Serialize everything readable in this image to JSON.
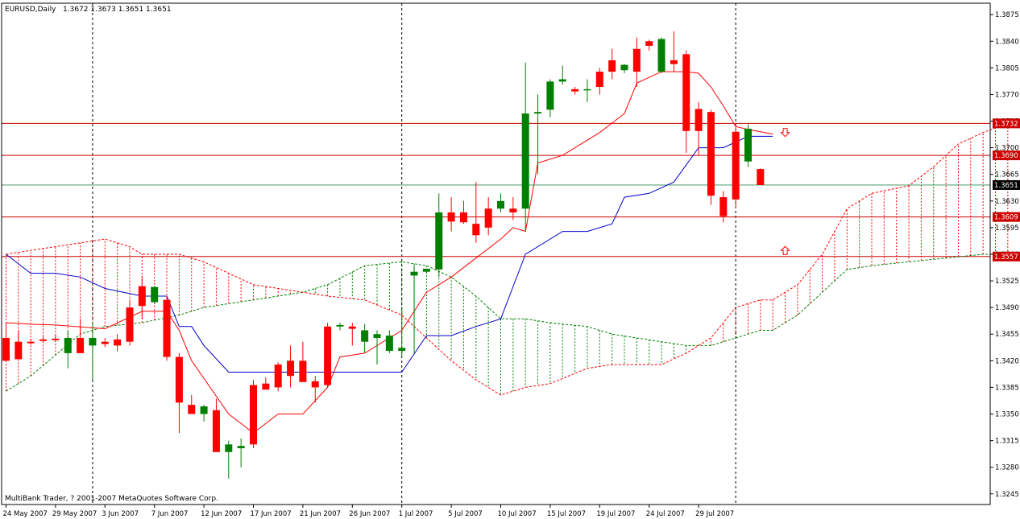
{
  "header": {
    "symbol": "EURUSD,Daily",
    "ohlc": "1.3672 1.3673 1.3651 1.3651"
  },
  "footer": {
    "copyright": "MultiBank Trader, ? 2001-2007 MetaQuotes Software Corp."
  },
  "colors": {
    "bull": "#008000",
    "bear": "#ff0000",
    "tenkan": "#ff0000",
    "kijun": "#0000cc",
    "span_a": "#008000",
    "span_b": "#ff0000",
    "hline": "#cc0000",
    "price_tag": "#000000"
  },
  "chart_data": {
    "type": "candlestick",
    "title": "",
    "ylim": [
      1.3231,
      1.389
    ],
    "y_ticks": [
      "1.3875",
      "1.3840",
      "1.3805",
      "1.3770",
      "1.3735",
      "1.3700",
      "1.3665",
      "1.3630",
      "1.3595",
      "1.3560",
      "1.3525",
      "1.3490",
      "1.3455",
      "1.3420",
      "1.3385",
      "1.3350",
      "1.3315",
      "1.3280",
      "1.3245"
    ],
    "x_ticks": [
      {
        "label": "24 May 2007",
        "bar": 0
      },
      {
        "label": "29 May 2007",
        "bar": 4
      },
      {
        "label": "3 Jun 2007",
        "bar": 8
      },
      {
        "label": "7 Jun 2007",
        "bar": 12
      },
      {
        "label": "12 Jun 2007",
        "bar": 16
      },
      {
        "label": "17 Jun 2007",
        "bar": 20
      },
      {
        "label": "21 Jun 2007",
        "bar": 24
      },
      {
        "label": "26 Jun 2007",
        "bar": 28
      },
      {
        "label": "1 Jul 2007",
        "bar": 32
      },
      {
        "label": "5 Jul 2007",
        "bar": 36
      },
      {
        "label": "10 Jul 2007",
        "bar": 40
      },
      {
        "label": "15 Jul 2007",
        "bar": 44
      },
      {
        "label": "19 Jul 2007",
        "bar": 48
      },
      {
        "label": "24 Jul 2007",
        "bar": 52
      },
      {
        "label": "29 Jul 2007",
        "bar": 56
      }
    ],
    "period_separators": [
      7,
      32,
      59
    ],
    "candles": [
      {
        "o": 1.345,
        "h": 1.347,
        "l": 1.342,
        "c": 1.342
      },
      {
        "o": 1.3445,
        "h": 1.346,
        "l": 1.3422,
        "c": 1.3422
      },
      {
        "o": 1.3445,
        "h": 1.3449,
        "l": 1.3441,
        "c": 1.3443
      },
      {
        "o": 1.3448,
        "h": 1.3452,
        "l": 1.3444,
        "c": 1.3446
      },
      {
        "o": 1.3449,
        "h": 1.3455,
        "l": 1.3445,
        "c": 1.3447
      },
      {
        "o": 1.343,
        "h": 1.346,
        "l": 1.341,
        "c": 1.345
      },
      {
        "o": 1.345,
        "h": 1.3475,
        "l": 1.343,
        "c": 1.343
      },
      {
        "o": 1.344,
        "h": 1.347,
        "l": 1.3395,
        "c": 1.345
      },
      {
        "o": 1.3445,
        "h": 1.345,
        "l": 1.3438,
        "c": 1.3442
      },
      {
        "o": 1.3448,
        "h": 1.3455,
        "l": 1.3432,
        "c": 1.344
      },
      {
        "o": 1.349,
        "h": 1.35,
        "l": 1.344,
        "c": 1.3445
      },
      {
        "o": 1.3518,
        "h": 1.353,
        "l": 1.3475,
        "c": 1.3492
      },
      {
        "o": 1.3497,
        "h": 1.3518,
        "l": 1.3495,
        "c": 1.3517
      },
      {
        "o": 1.35,
        "h": 1.3505,
        "l": 1.342,
        "c": 1.3425
      },
      {
        "o": 1.3425,
        "h": 1.343,
        "l": 1.3325,
        "c": 1.3365
      },
      {
        "o": 1.3362,
        "h": 1.3375,
        "l": 1.3355,
        "c": 1.335
      },
      {
        "o": 1.335,
        "h": 1.3362,
        "l": 1.334,
        "c": 1.336
      },
      {
        "o": 1.3355,
        "h": 1.337,
        "l": 1.33,
        "c": 1.33
      },
      {
        "o": 1.33,
        "h": 1.3315,
        "l": 1.3265,
        "c": 1.331
      },
      {
        "o": 1.3305,
        "h": 1.3318,
        "l": 1.328,
        "c": 1.3308
      },
      {
        "o": 1.3388,
        "h": 1.3395,
        "l": 1.3305,
        "c": 1.331
      },
      {
        "o": 1.339,
        "h": 1.3398,
        "l": 1.3385,
        "c": 1.3382
      },
      {
        "o": 1.3415,
        "h": 1.3418,
        "l": 1.338,
        "c": 1.3385
      },
      {
        "o": 1.342,
        "h": 1.344,
        "l": 1.3385,
        "c": 1.34
      },
      {
        "o": 1.342,
        "h": 1.3445,
        "l": 1.3405,
        "c": 1.3392
      },
      {
        "o": 1.3393,
        "h": 1.34,
        "l": 1.3365,
        "c": 1.3385
      },
      {
        "o": 1.3465,
        "h": 1.347,
        "l": 1.3385,
        "c": 1.3388
      },
      {
        "o": 1.3465,
        "h": 1.347,
        "l": 1.346,
        "c": 1.3467
      },
      {
        "o": 1.3465,
        "h": 1.347,
        "l": 1.344,
        "c": 1.3462
      },
      {
        "o": 1.3445,
        "h": 1.3468,
        "l": 1.343,
        "c": 1.346
      },
      {
        "o": 1.345,
        "h": 1.346,
        "l": 1.3415,
        "c": 1.3455
      },
      {
        "o": 1.3433,
        "h": 1.346,
        "l": 1.343,
        "c": 1.3453
      },
      {
        "o": 1.3433,
        "h": 1.349,
        "l": 1.3425,
        "c": 1.3437
      },
      {
        "o": 1.3532,
        "h": 1.3545,
        "l": 1.343,
        "c": 1.3537
      },
      {
        "o": 1.3537,
        "h": 1.354,
        "l": 1.3535,
        "c": 1.3541
      },
      {
        "o": 1.354,
        "h": 1.364,
        "l": 1.353,
        "c": 1.3615
      },
      {
        "o": 1.3615,
        "h": 1.3635,
        "l": 1.359,
        "c": 1.3603
      },
      {
        "o": 1.3615,
        "h": 1.363,
        "l": 1.36,
        "c": 1.3602
      },
      {
        "o": 1.36,
        "h": 1.3655,
        "l": 1.3575,
        "c": 1.3585
      },
      {
        "o": 1.362,
        "h": 1.3635,
        "l": 1.3585,
        "c": 1.3595
      },
      {
        "o": 1.362,
        "h": 1.364,
        "l": 1.3615,
        "c": 1.363
      },
      {
        "o": 1.362,
        "h": 1.3635,
        "l": 1.3605,
        "c": 1.3615
      },
      {
        "o": 1.362,
        "h": 1.3812,
        "l": 1.359,
        "c": 1.3745
      },
      {
        "o": 1.3745,
        "h": 1.377,
        "l": 1.3665,
        "c": 1.3747
      },
      {
        "o": 1.375,
        "h": 1.379,
        "l": 1.374,
        "c": 1.3787
      },
      {
        "o": 1.3787,
        "h": 1.3808,
        "l": 1.3783,
        "c": 1.379
      },
      {
        "o": 1.3777,
        "h": 1.378,
        "l": 1.377,
        "c": 1.3774
      },
      {
        "o": 1.3777,
        "h": 1.379,
        "l": 1.376,
        "c": 1.3777
      },
      {
        "o": 1.38,
        "h": 1.3805,
        "l": 1.377,
        "c": 1.378
      },
      {
        "o": 1.3815,
        "h": 1.383,
        "l": 1.379,
        "c": 1.38
      },
      {
        "o": 1.3802,
        "h": 1.381,
        "l": 1.3798,
        "c": 1.3809
      },
      {
        "o": 1.383,
        "h": 1.3845,
        "l": 1.378,
        "c": 1.38
      },
      {
        "o": 1.384,
        "h": 1.3842,
        "l": 1.3828,
        "c": 1.3834
      },
      {
        "o": 1.38,
        "h": 1.3845,
        "l": 1.3798,
        "c": 1.3843
      },
      {
        "o": 1.3815,
        "h": 1.3853,
        "l": 1.38,
        "c": 1.381
      },
      {
        "o": 1.3823,
        "h": 1.3828,
        "l": 1.3693,
        "c": 1.3722
      },
      {
        "o": 1.3751,
        "h": 1.376,
        "l": 1.369,
        "c": 1.3722
      },
      {
        "o": 1.3747,
        "h": 1.375,
        "l": 1.3625,
        "c": 1.3637
      },
      {
        "o": 1.3635,
        "h": 1.3643,
        "l": 1.3602,
        "c": 1.361
      },
      {
        "o": 1.3721,
        "h": 1.3727,
        "l": 1.362,
        "c": 1.3632
      },
      {
        "o": 1.3682,
        "h": 1.3731,
        "l": 1.3675,
        "c": 1.3725
      },
      {
        "o": 1.3672,
        "h": 1.3673,
        "l": 1.3651,
        "c": 1.3651
      }
    ],
    "series": [
      {
        "key": "tenkan",
        "values": [
          [
            0,
            1.347
          ],
          [
            2,
            1.3468
          ],
          [
            4,
            1.3467
          ],
          [
            8,
            1.3462
          ],
          [
            11,
            1.3485
          ],
          [
            13,
            1.3485
          ],
          [
            14,
            1.346
          ],
          [
            15,
            1.342
          ],
          [
            18,
            1.335
          ],
          [
            20,
            1.3325
          ],
          [
            22,
            1.335
          ],
          [
            24,
            1.335
          ],
          [
            26,
            1.3385
          ],
          [
            27,
            1.3425
          ],
          [
            29,
            1.343
          ],
          [
            32,
            1.346
          ],
          [
            34,
            1.351
          ],
          [
            36,
            1.353
          ],
          [
            38,
            1.3555
          ],
          [
            40,
            1.358
          ],
          [
            41,
            1.3595
          ],
          [
            42,
            1.359
          ],
          [
            43,
            1.368
          ],
          [
            45,
            1.369
          ],
          [
            47,
            1.371
          ],
          [
            48,
            1.372
          ],
          [
            50,
            1.3745
          ],
          [
            51,
            1.3785
          ],
          [
            53,
            1.38
          ],
          [
            55,
            1.38
          ],
          [
            56,
            1.3798
          ],
          [
            57,
            1.378
          ],
          [
            58,
            1.3755
          ],
          [
            59,
            1.3728
          ],
          [
            60,
            1.3724
          ],
          [
            62,
            1.3718
          ]
        ]
      },
      {
        "key": "kijun",
        "values": [
          [
            0,
            1.356
          ],
          [
            2,
            1.3535
          ],
          [
            4,
            1.3535
          ],
          [
            6,
            1.353
          ],
          [
            8,
            1.3515
          ],
          [
            11,
            1.3505
          ],
          [
            13,
            1.3505
          ],
          [
            14,
            1.3465
          ],
          [
            15,
            1.3465
          ],
          [
            16,
            1.344
          ],
          [
            18,
            1.3405
          ],
          [
            32,
            1.3405
          ],
          [
            34,
            1.3453
          ],
          [
            36,
            1.3453
          ],
          [
            38,
            1.3465
          ],
          [
            40,
            1.3475
          ],
          [
            42,
            1.356
          ],
          [
            45,
            1.359
          ],
          [
            47,
            1.359
          ],
          [
            49,
            1.36
          ],
          [
            50,
            1.3635
          ],
          [
            52,
            1.364
          ],
          [
            54,
            1.3655
          ],
          [
            56,
            1.37
          ],
          [
            58,
            1.37
          ],
          [
            60,
            1.3715
          ],
          [
            62,
            1.3715
          ]
        ]
      },
      {
        "key": "span_a",
        "values": [
          [
            0,
            1.338
          ],
          [
            2,
            1.34
          ],
          [
            6,
            1.3455
          ],
          [
            8,
            1.3465
          ],
          [
            11,
            1.347
          ],
          [
            14,
            1.348
          ],
          [
            16,
            1.349
          ],
          [
            20,
            1.35
          ],
          [
            24,
            1.351
          ],
          [
            26,
            1.352
          ],
          [
            29,
            1.3545
          ],
          [
            32,
            1.355
          ],
          [
            34,
            1.3545
          ],
          [
            36,
            1.353
          ],
          [
            38,
            1.3505
          ],
          [
            40,
            1.3475
          ],
          [
            42,
            1.3475
          ],
          [
            44,
            1.347
          ],
          [
            47,
            1.3465
          ],
          [
            49,
            1.3455
          ],
          [
            51,
            1.345
          ],
          [
            53,
            1.3445
          ],
          [
            55,
            1.344
          ],
          [
            57,
            1.344
          ],
          [
            59,
            1.345
          ],
          [
            61,
            1.346
          ],
          [
            62,
            1.346
          ],
          [
            64,
            1.348
          ],
          [
            66,
            1.351
          ],
          [
            68,
            1.354
          ],
          [
            70,
            1.3545
          ],
          [
            73,
            1.355
          ],
          [
            76,
            1.3555
          ],
          [
            79,
            1.356
          ],
          [
            81,
            1.356
          ]
        ]
      },
      {
        "key": "span_b",
        "values": [
          [
            0,
            1.356
          ],
          [
            2,
            1.3565
          ],
          [
            4,
            1.357
          ],
          [
            6,
            1.3575
          ],
          [
            8,
            1.358
          ],
          [
            10,
            1.357
          ],
          [
            11,
            1.356
          ],
          [
            14,
            1.356
          ],
          [
            16,
            1.355
          ],
          [
            20,
            1.352
          ],
          [
            24,
            1.351
          ],
          [
            26,
            1.3505
          ],
          [
            29,
            1.35
          ],
          [
            32,
            1.348
          ],
          [
            34,
            1.345
          ],
          [
            36,
            1.342
          ],
          [
            38,
            1.3395
          ],
          [
            40,
            1.3375
          ],
          [
            42,
            1.3385
          ],
          [
            44,
            1.339
          ],
          [
            47,
            1.341
          ],
          [
            49,
            1.3415
          ],
          [
            51,
            1.3415
          ],
          [
            53,
            1.3415
          ],
          [
            55,
            1.343
          ],
          [
            57,
            1.345
          ],
          [
            59,
            1.349
          ],
          [
            61,
            1.35
          ],
          [
            62,
            1.35
          ],
          [
            64,
            1.352
          ],
          [
            66,
            1.356
          ],
          [
            68,
            1.362
          ],
          [
            70,
            1.364
          ],
          [
            73,
            1.365
          ],
          [
            75,
            1.3675
          ],
          [
            77,
            1.3705
          ],
          [
            79,
            1.372
          ],
          [
            81,
            1.3732
          ]
        ]
      }
    ],
    "hlines": [
      {
        "value": 1.3732,
        "label": "1.3732"
      },
      {
        "value": 1.369,
        "label": "1.3690"
      },
      {
        "value": 1.3609,
        "label": "1.3609"
      },
      {
        "value": 1.3557,
        "label": "1.3557"
      }
    ],
    "current_price": {
      "value": 1.3651,
      "label": "1.3651"
    },
    "arrows": [
      {
        "direction": "down",
        "bar": 63,
        "value": 1.372
      },
      {
        "direction": "up",
        "bar": 63,
        "value": 1.3565
      }
    ]
  }
}
